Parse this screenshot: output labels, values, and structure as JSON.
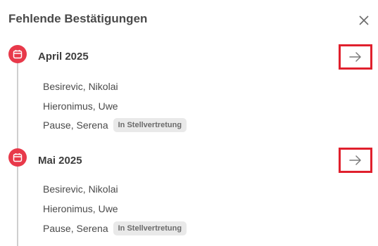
{
  "panel": {
    "title": "Fehlende Bestätigungen",
    "close_icon": "close-icon"
  },
  "months": [
    {
      "label": "April 2025",
      "icon": "calendar-icon",
      "arrow_icon": "arrow-right-icon",
      "people": [
        {
          "name": "Besirevic, Nikolai",
          "badge": ""
        },
        {
          "name": "Hieronimus, Uwe",
          "badge": ""
        },
        {
          "name": "Pause, Serena",
          "badge": "In Stellvertretung"
        }
      ]
    },
    {
      "label": "Mai 2025",
      "icon": "calendar-icon",
      "arrow_icon": "arrow-right-icon",
      "people": [
        {
          "name": "Besirevic, Nikolai",
          "badge": ""
        },
        {
          "name": "Hieronimus, Uwe",
          "badge": ""
        },
        {
          "name": "Pause, Serena",
          "badge": "In Stellvertretung"
        }
      ]
    }
  ],
  "colors": {
    "accent": "#e8394a",
    "highlight_border": "#e0202d",
    "badge_bg": "#e9e9e9",
    "timeline": "#cfcfcf"
  }
}
